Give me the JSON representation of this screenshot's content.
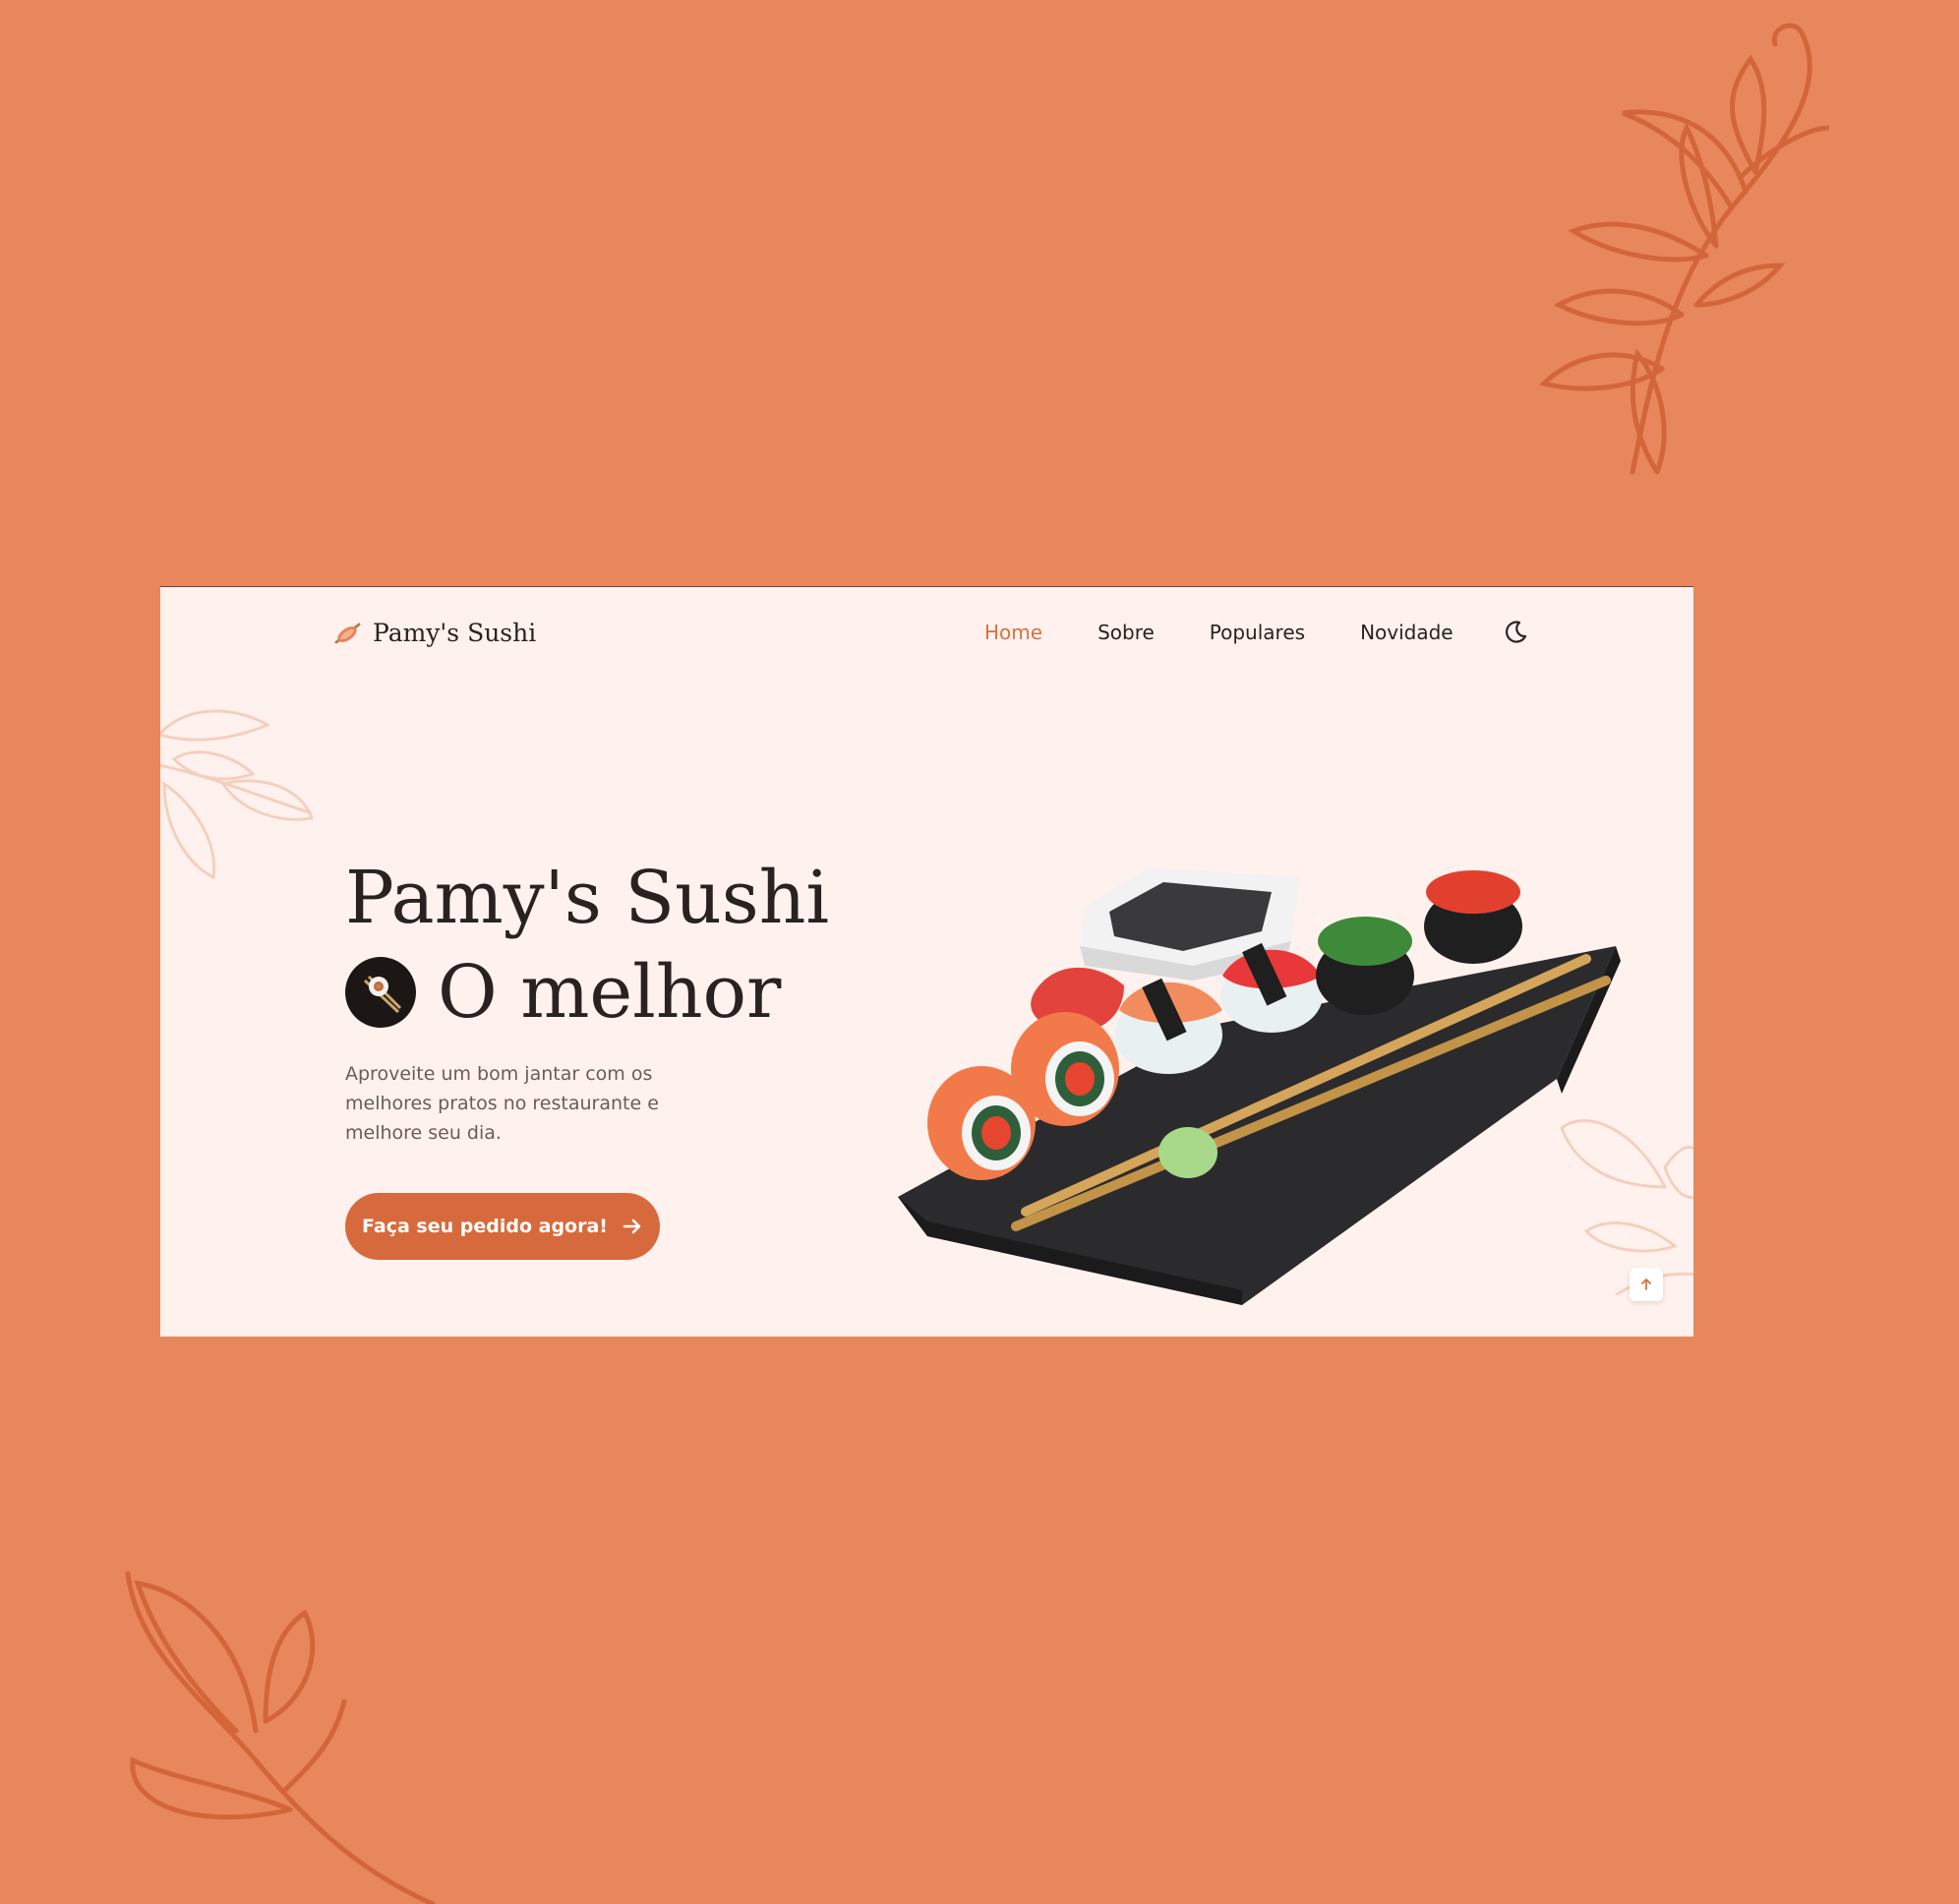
{
  "colors": {
    "page_background": "#e9875c",
    "site_background": "#fff2ee",
    "accent": "#d66a3c",
    "nav_active": "#d9703f",
    "text_dark": "#2a2220"
  },
  "header": {
    "logo_icon": "sushi-roll-icon",
    "logo_text": "Pamy's Sushi",
    "nav": [
      {
        "label": "Home",
        "active": true
      },
      {
        "label": "Sobre",
        "active": false
      },
      {
        "label": "Populares",
        "active": false
      },
      {
        "label": "Novidade",
        "active": false
      }
    ],
    "theme_toggle_icon": "moon-icon"
  },
  "hero": {
    "title_line1": "Pamy's Sushi",
    "title_line2": "O melhor",
    "title_icon": "sushi-chopsticks-icon",
    "description": "Aproveite um bom jantar com os melhores pratos no restaurante e melhore seu dia.",
    "cta_label": "Faça seu pedido agora!",
    "cta_icon": "arrow-right-icon"
  },
  "scroll_top_icon": "arrow-up-icon"
}
